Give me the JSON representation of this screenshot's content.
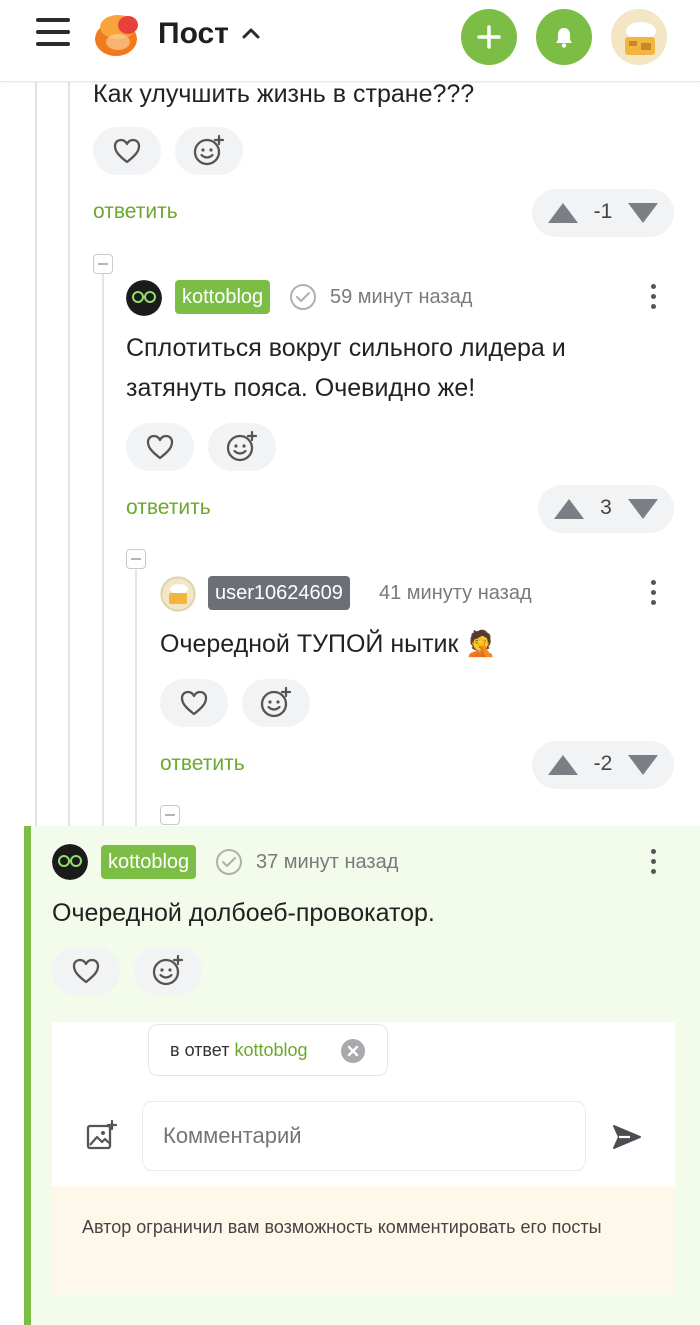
{
  "header": {
    "title": "Пост",
    "add_icon": "plus-icon",
    "bell_icon": "bell-icon",
    "colors": {
      "accent": "#7cbd46",
      "logo": "#f07a1c"
    }
  },
  "comments": [
    {
      "text": "Как улучшить жизнь в стране???",
      "reply_label": "ответить",
      "rating": "-1"
    },
    {
      "author": "kottoblog",
      "time": "59 минут назад",
      "text_line1": "Сплотиться вокруг сильного лидера и",
      "text_line2": "затянуть пояса. Очевидно же!",
      "reply_label": "ответить",
      "rating": "3"
    },
    {
      "author": "user10624609",
      "time": "41 минуту назад",
      "text": "Очередной ТУПОЙ нытик 🤦",
      "reply_label": "ответить",
      "rating": "-2"
    },
    {
      "author": "kottoblog",
      "time": "37 минут назад",
      "text": "Очередной долбоеб-провокатор."
    }
  ],
  "reply_form": {
    "reply_to_prefix": "в ответ",
    "reply_to_user": "kottoblog",
    "placeholder": "Комментарий",
    "notice": "Автор ограничил вам возможность комментировать его посты"
  }
}
